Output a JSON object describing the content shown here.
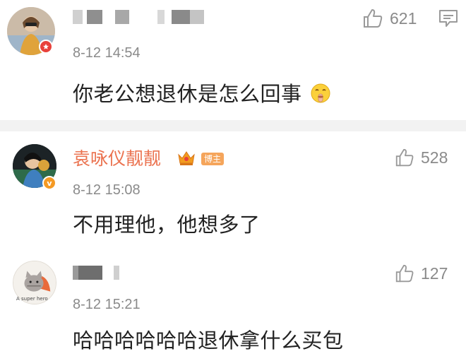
{
  "comments": [
    {
      "username": "",
      "timestamp": "8-12 14:54",
      "text": "你老公想退休是怎么回事",
      "emoji": "shush-face-icon",
      "likes": "621",
      "badge": "v-badge-red"
    },
    {
      "username": "袁咏仪靓靓",
      "timestamp": "8-12 15:08",
      "text": "不用理他，他想多了",
      "likes": "528",
      "badge": "v-badge-orange",
      "tag": "博主"
    },
    {
      "username": "",
      "timestamp": "8-12 15:21",
      "text": "哈哈哈哈哈哈退休拿什么买包",
      "likes": "127",
      "avatar_caption": "A super hero"
    }
  ],
  "colors": {
    "accent_username": "#eb7350",
    "meta_gray": "#8a8a8a",
    "separator_band": "#f2f2f2"
  }
}
